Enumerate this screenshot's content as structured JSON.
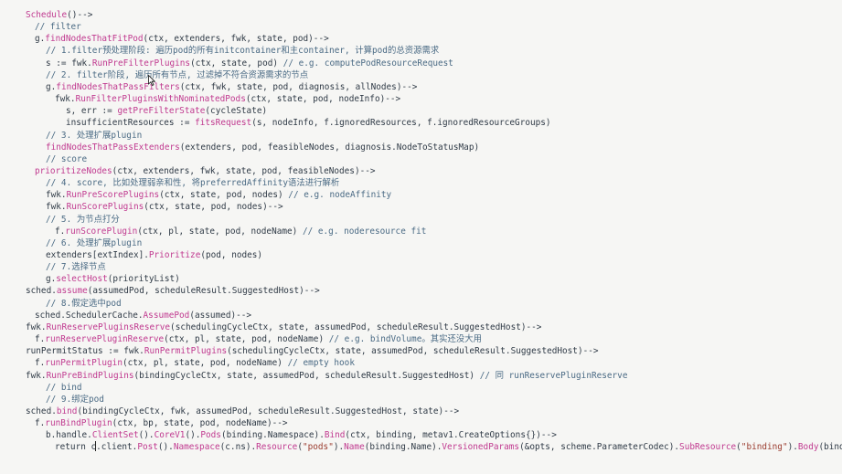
{
  "editor": {
    "colors": {
      "background": "#f6f6f4",
      "plain": "#2f3a46",
      "function": "#c0398f",
      "comment": "#4a6a84",
      "string": "#9a3b2e"
    },
    "lines": [
      {
        "indent": 28,
        "tokens": [
          [
            "fn",
            "Schedule"
          ],
          [
            "pl",
            "()-->"
          ]
        ]
      },
      {
        "indent": 38,
        "tokens": [
          [
            "cm",
            "// filter"
          ]
        ]
      },
      {
        "indent": 38,
        "tokens": [
          [
            "pl",
            "g."
          ],
          [
            "fn",
            "findNodesThatFitPod"
          ],
          [
            "pl",
            "(ctx, extenders, fwk, state, pod)-->"
          ]
        ]
      },
      {
        "indent": 50,
        "tokens": [
          [
            "cm",
            "// 1.filter预处理阶段: 遍历pod的所有initcontainer和主container, 计算pod的总资源需求"
          ]
        ]
      },
      {
        "indent": 50,
        "tokens": [
          [
            "pl",
            "s := fwk."
          ],
          [
            "fn",
            "RunPreFilterPlugins"
          ],
          [
            "pl",
            "(ctx, state, pod) "
          ],
          [
            "cm",
            "// e.g. computePodResourceRequest"
          ]
        ]
      },
      {
        "indent": 50,
        "tokens": [
          [
            "cm",
            "// 2. filter阶段, 遍历所有节点, 过滤掉不符合资源需求的节点"
          ]
        ]
      },
      {
        "indent": 50,
        "tokens": [
          [
            "pl",
            "g."
          ],
          [
            "fn",
            "findNodesThatPassFilters"
          ],
          [
            "pl",
            "(ctx, fwk, state, pod, diagnosis, allNodes)-->"
          ]
        ]
      },
      {
        "indent": 60,
        "tokens": [
          [
            "pl",
            "fwk."
          ],
          [
            "fn",
            "RunFilterPluginsWithNominatedPods"
          ],
          [
            "pl",
            "(ctx, state, pod, nodeInfo)-->"
          ]
        ]
      },
      {
        "indent": 72,
        "tokens": [
          [
            "pl",
            "s, err := "
          ],
          [
            "fn",
            "getPreFilterState"
          ],
          [
            "pl",
            "(cycleState)"
          ]
        ]
      },
      {
        "indent": 72,
        "tokens": [
          [
            "pl",
            "insufficientResources := "
          ],
          [
            "fn",
            "fitsRequest"
          ],
          [
            "pl",
            "(s, nodeInfo, f.ignoredResources, f.ignoredResourceGroups)"
          ]
        ]
      },
      {
        "indent": 50,
        "tokens": [
          [
            "cm",
            "// 3. 处理扩展plugin"
          ]
        ]
      },
      {
        "indent": 50,
        "tokens": [
          [
            "fn",
            "findNodesThatPassExtenders"
          ],
          [
            "pl",
            "(extenders, pod, feasibleNodes, diagnosis.NodeToStatusMap)"
          ]
        ]
      },
      {
        "indent": 50,
        "tokens": [
          [
            "cm",
            "// score"
          ]
        ]
      },
      {
        "indent": 38,
        "tokens": [
          [
            "fn",
            "prioritizeNodes"
          ],
          [
            "pl",
            "(ctx, extenders, fwk, state, pod, feasibleNodes)-->"
          ]
        ]
      },
      {
        "indent": 50,
        "tokens": [
          [
            "cm",
            "// 4. score, 比如处理弱亲和性, 将preferredAffinity语法进行解析"
          ]
        ]
      },
      {
        "indent": 50,
        "tokens": [
          [
            "pl",
            "fwk."
          ],
          [
            "fn",
            "RunPreScorePlugins"
          ],
          [
            "pl",
            "(ctx, state, pod, nodes) "
          ],
          [
            "cm",
            "// e.g. nodeAffinity"
          ]
        ]
      },
      {
        "indent": 50,
        "tokens": [
          [
            "pl",
            "fwk."
          ],
          [
            "fn",
            "RunScorePlugins"
          ],
          [
            "pl",
            "(ctx, state, pod, nodes)-->"
          ]
        ]
      },
      {
        "indent": 50,
        "tokens": [
          [
            "cm",
            "// 5. 为节点打分"
          ]
        ]
      },
      {
        "indent": 60,
        "tokens": [
          [
            "pl",
            "f."
          ],
          [
            "fn",
            "runScorePlugin"
          ],
          [
            "pl",
            "(ctx, pl, state, pod, nodeName) "
          ],
          [
            "cm",
            "// e.g. noderesource fit"
          ]
        ]
      },
      {
        "indent": 50,
        "tokens": [
          [
            "cm",
            "// 6. 处理扩展plugin"
          ]
        ]
      },
      {
        "indent": 50,
        "tokens": [
          [
            "pl",
            "extenders[extIndex]."
          ],
          [
            "fn",
            "Prioritize"
          ],
          [
            "pl",
            "(pod, nodes)"
          ]
        ]
      },
      {
        "indent": 50,
        "tokens": [
          [
            "cm",
            "// 7.选择节点"
          ]
        ]
      },
      {
        "indent": 50,
        "tokens": [
          [
            "pl",
            "g."
          ],
          [
            "fn",
            "selectHost"
          ],
          [
            "pl",
            "(priorityList)"
          ]
        ]
      },
      {
        "indent": 28,
        "tokens": [
          [
            "pl",
            "sched."
          ],
          [
            "fn",
            "assume"
          ],
          [
            "pl",
            "(assumedPod, scheduleResult.SuggestedHost)-->"
          ]
        ]
      },
      {
        "indent": 50,
        "tokens": [
          [
            "cm",
            "// 8.假定选中pod"
          ]
        ]
      },
      {
        "indent": 38,
        "tokens": [
          [
            "pl",
            "sched.SchedulerCache."
          ],
          [
            "fn",
            "AssumePod"
          ],
          [
            "pl",
            "(assumed)-->"
          ]
        ]
      },
      {
        "indent": 28,
        "tokens": [
          [
            "pl",
            "fwk."
          ],
          [
            "fn",
            "RunReservePluginsReserve"
          ],
          [
            "pl",
            "(schedulingCycleCtx, state, assumedPod, scheduleResult.SuggestedHost)-->"
          ]
        ]
      },
      {
        "indent": 38,
        "tokens": [
          [
            "pl",
            "f."
          ],
          [
            "fn",
            "runReservePluginReserve"
          ],
          [
            "pl",
            "(ctx, pl, state, pod, nodeName) "
          ],
          [
            "cm",
            "// e.g. bindVolume。其实还没大用"
          ]
        ]
      },
      {
        "indent": 28,
        "tokens": [
          [
            "pl",
            "runPermitStatus := fwk."
          ],
          [
            "fn",
            "RunPermitPlugins"
          ],
          [
            "pl",
            "(schedulingCycleCtx, state, assumedPod, scheduleResult.SuggestedHost)-->"
          ]
        ]
      },
      {
        "indent": 38,
        "tokens": [
          [
            "pl",
            "f."
          ],
          [
            "fn",
            "runPermitPlugin"
          ],
          [
            "pl",
            "(ctx, pl, state, pod, nodeName) "
          ],
          [
            "cm",
            "// empty hook"
          ]
        ]
      },
      {
        "indent": 28,
        "tokens": [
          [
            "pl",
            "fwk."
          ],
          [
            "fn",
            "RunPreBindPlugins"
          ],
          [
            "pl",
            "(bindingCycleCtx, state, assumedPod, scheduleResult.SuggestedHost) "
          ],
          [
            "cm",
            "// 同 runReservePluginReserve"
          ]
        ]
      },
      {
        "indent": 50,
        "tokens": [
          [
            "cm",
            "// bind"
          ]
        ]
      },
      {
        "indent": 50,
        "tokens": [
          [
            "cm",
            "// 9.绑定pod"
          ]
        ]
      },
      {
        "indent": 28,
        "tokens": [
          [
            "pl",
            "sched."
          ],
          [
            "fn",
            "bind"
          ],
          [
            "pl",
            "(bindingCycleCtx, fwk, assumedPod, scheduleResult.SuggestedHost, state)-->"
          ]
        ]
      },
      {
        "indent": 38,
        "tokens": [
          [
            "pl",
            "f."
          ],
          [
            "fn",
            "runBindPlugin"
          ],
          [
            "pl",
            "(ctx, bp, state, pod, nodeName)-->"
          ]
        ]
      },
      {
        "indent": 50,
        "tokens": [
          [
            "pl",
            "b.handle."
          ],
          [
            "fn",
            "ClientSet"
          ],
          [
            "pl",
            "()."
          ],
          [
            "fn",
            "CoreV1"
          ],
          [
            "pl",
            "()."
          ],
          [
            "fn",
            "Pods"
          ],
          [
            "pl",
            "(binding.Namespace)."
          ],
          [
            "fn",
            "Bind"
          ],
          [
            "pl",
            "(ctx, binding, metav1.CreateOptions{})-->"
          ]
        ]
      },
      {
        "indent": 60,
        "tokens": [
          [
            "pl",
            "return c"
          ],
          [
            "cursor",
            ""
          ],
          [
            "pl",
            ".client."
          ],
          [
            "fn",
            "Post"
          ],
          [
            "pl",
            "()."
          ],
          [
            "fn",
            "Namespace"
          ],
          [
            "pl",
            "(c.ns)."
          ],
          [
            "fn",
            "Resource"
          ],
          [
            "pl",
            "("
          ],
          [
            "str",
            "\"pods\""
          ],
          [
            "pl",
            ")."
          ],
          [
            "fn",
            "Name"
          ],
          [
            "pl",
            "(binding.Name)."
          ],
          [
            "fn",
            "VersionedParams"
          ],
          [
            "pl",
            "(&opts, scheme.ParameterCodec)."
          ],
          [
            "fn",
            "SubResource"
          ],
          [
            "pl",
            "("
          ],
          [
            "str",
            "\"binding\""
          ],
          [
            "pl",
            ")."
          ],
          [
            "fn",
            "Body"
          ],
          [
            "pl",
            "(binding"
          ]
        ]
      }
    ]
  }
}
